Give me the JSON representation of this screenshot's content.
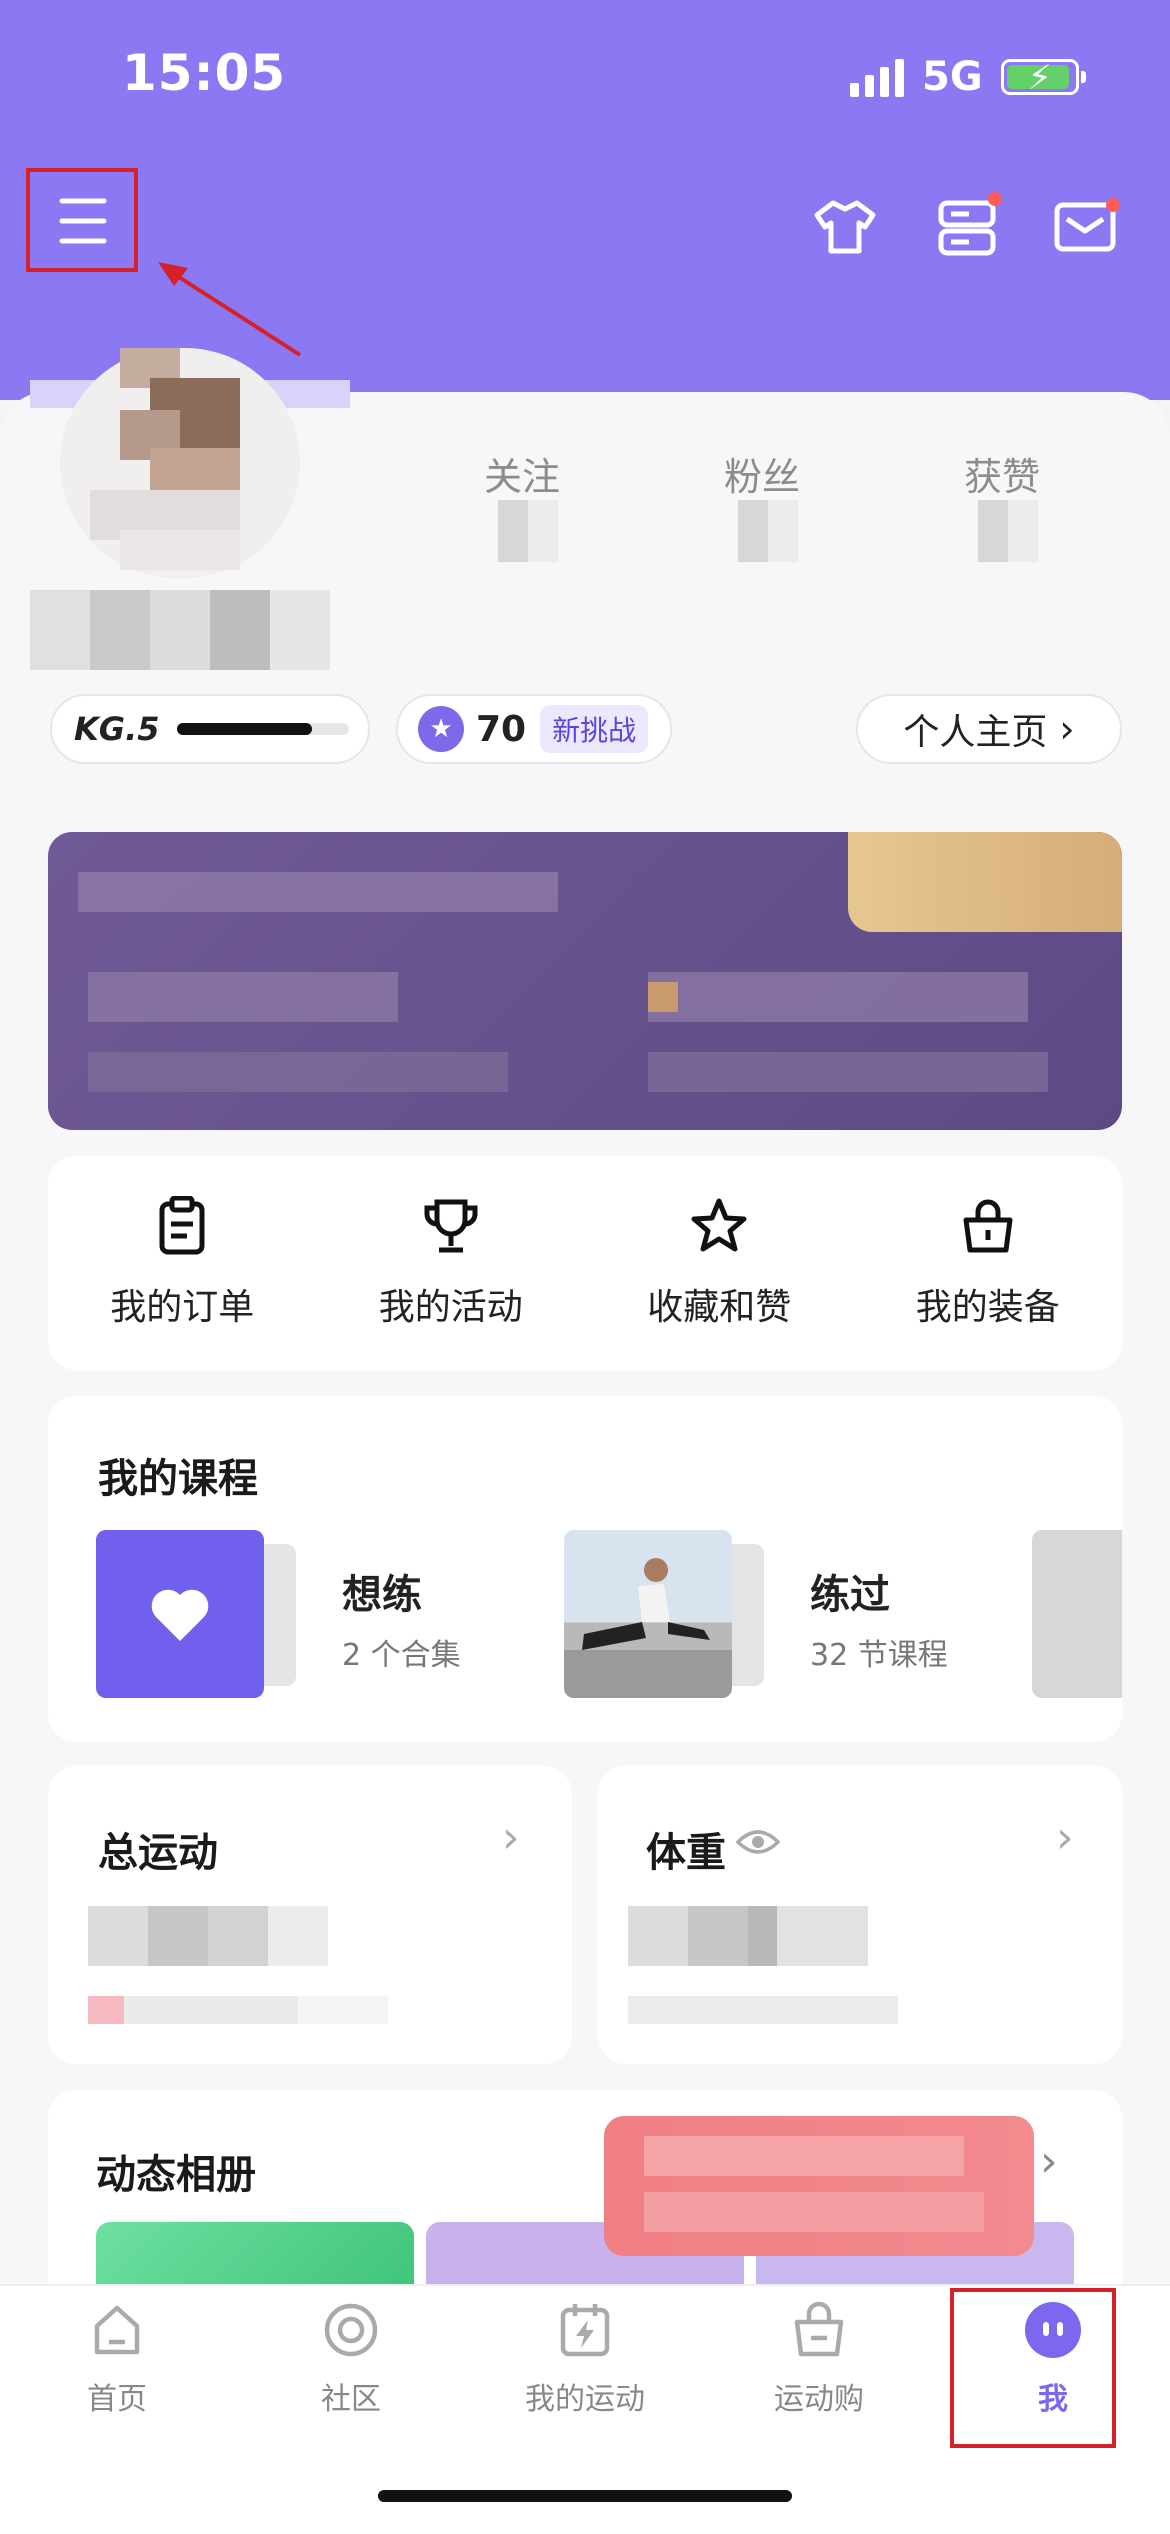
{
  "status_bar": {
    "time": "15:05",
    "network": "5G"
  },
  "header": {
    "menu_icon": "hamburger-menu-icon",
    "actions": [
      "tshirt-icon",
      "server-icon",
      "mail-icon"
    ]
  },
  "profile": {
    "stats": [
      {
        "label": "关注"
      },
      {
        "label": "粉丝"
      },
      {
        "label": "获赞"
      }
    ],
    "level": {
      "label": "KG.5",
      "progress": 0.78
    },
    "points": {
      "value": "70",
      "challenge_label": "新挑战"
    },
    "homepage_label": "个人主页"
  },
  "quick_menu": [
    {
      "label": "我的订单",
      "icon": "clipboard-icon"
    },
    {
      "label": "我的活动",
      "icon": "trophy-icon"
    },
    {
      "label": "收藏和赞",
      "icon": "star-icon"
    },
    {
      "label": "我的装备",
      "icon": "shopping-bag-icon"
    }
  ],
  "courses": {
    "title": "我的课程",
    "items": [
      {
        "title": "想练",
        "subtitle": "2 个合集"
      },
      {
        "title": "练过",
        "subtitle": "32 节课程"
      }
    ]
  },
  "total_exercise": {
    "title": "总运动"
  },
  "weight": {
    "title": "体重"
  },
  "album": {
    "title": "动态相册"
  },
  "tabs": [
    {
      "label": "首页",
      "icon": "home-icon",
      "active": false
    },
    {
      "label": "社区",
      "icon": "community-icon",
      "active": false
    },
    {
      "label": "我的运动",
      "icon": "calendar-bolt-icon",
      "active": false
    },
    {
      "label": "运动购",
      "icon": "shopping-bag-icon",
      "active": false
    },
    {
      "label": "我",
      "icon": "me-face-icon",
      "active": true
    }
  ],
  "colors": {
    "accent": "#8a79f2",
    "active_tab": "#7b68ee",
    "highlight_box": "#d6202a"
  }
}
